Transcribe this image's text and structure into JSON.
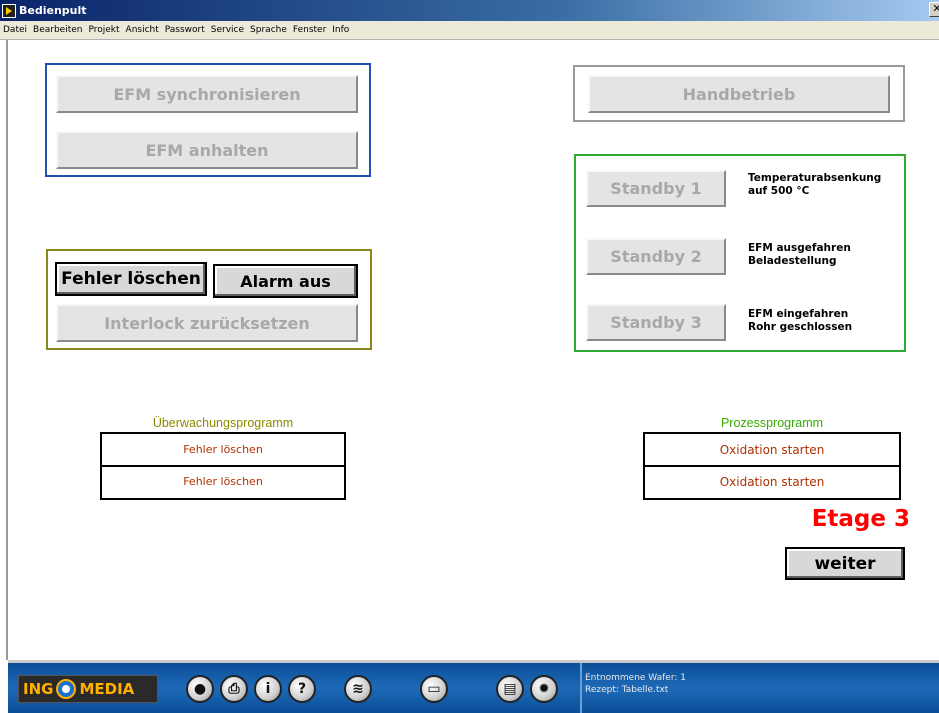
{
  "window": {
    "title": "Bedienpult"
  },
  "menu": [
    "Datei",
    "Bearbeiten",
    "Projekt",
    "Ansicht",
    "Passwort",
    "Service",
    "Sprache",
    "Fenster",
    "Info"
  ],
  "efm": {
    "sync_label": "EFM synchronisieren",
    "stop_label": "EFM anhalten"
  },
  "manual": {
    "label": "Handbetrieb"
  },
  "errors": {
    "clear_label": "Fehler löschen",
    "alarm_off_label": "Alarm aus",
    "interlock_label": "Interlock zurücksetzen"
  },
  "standby": [
    {
      "label": "Standby 1",
      "note_1": "Temperaturabsenkung",
      "note_2": "auf 500 °C"
    },
    {
      "label": "Standby 2",
      "note_1": "EFM ausgefahren",
      "note_2": "Beladestellung"
    },
    {
      "label": "Standby 3",
      "note_1": "EFM eingefahren",
      "note_2": "Rohr geschlossen"
    }
  ],
  "monitoring": {
    "title": "Überwachungsprogramm",
    "items": [
      "Fehler löschen",
      "Fehler löschen"
    ]
  },
  "process": {
    "title": "Prozessprogramm",
    "items": [
      "Oxidation starten",
      "Oxidation starten"
    ]
  },
  "etage": {
    "label": "Etage 3"
  },
  "next": {
    "label": "weiter"
  },
  "footer": {
    "logo_left": "ING",
    "logo_right": "MEDIA",
    "wafer_text": "Entnommene Wafer: 1",
    "recipe_text": "Rezept:  Tabelle.txt"
  },
  "colors": {
    "efm_frame": "#1f4fb8",
    "errors_frame": "#8a8a1a",
    "standby_frame": "#2ea82e",
    "monitoring_title": "#8a8a00",
    "process_title": "#38a800",
    "etage": "#ff0000"
  },
  "toolbar_icons": [
    "record-icon",
    "printer-icon",
    "info-icon",
    "help-icon",
    "layers-icon",
    "film-icon",
    "document-icon",
    "gear-icon"
  ]
}
